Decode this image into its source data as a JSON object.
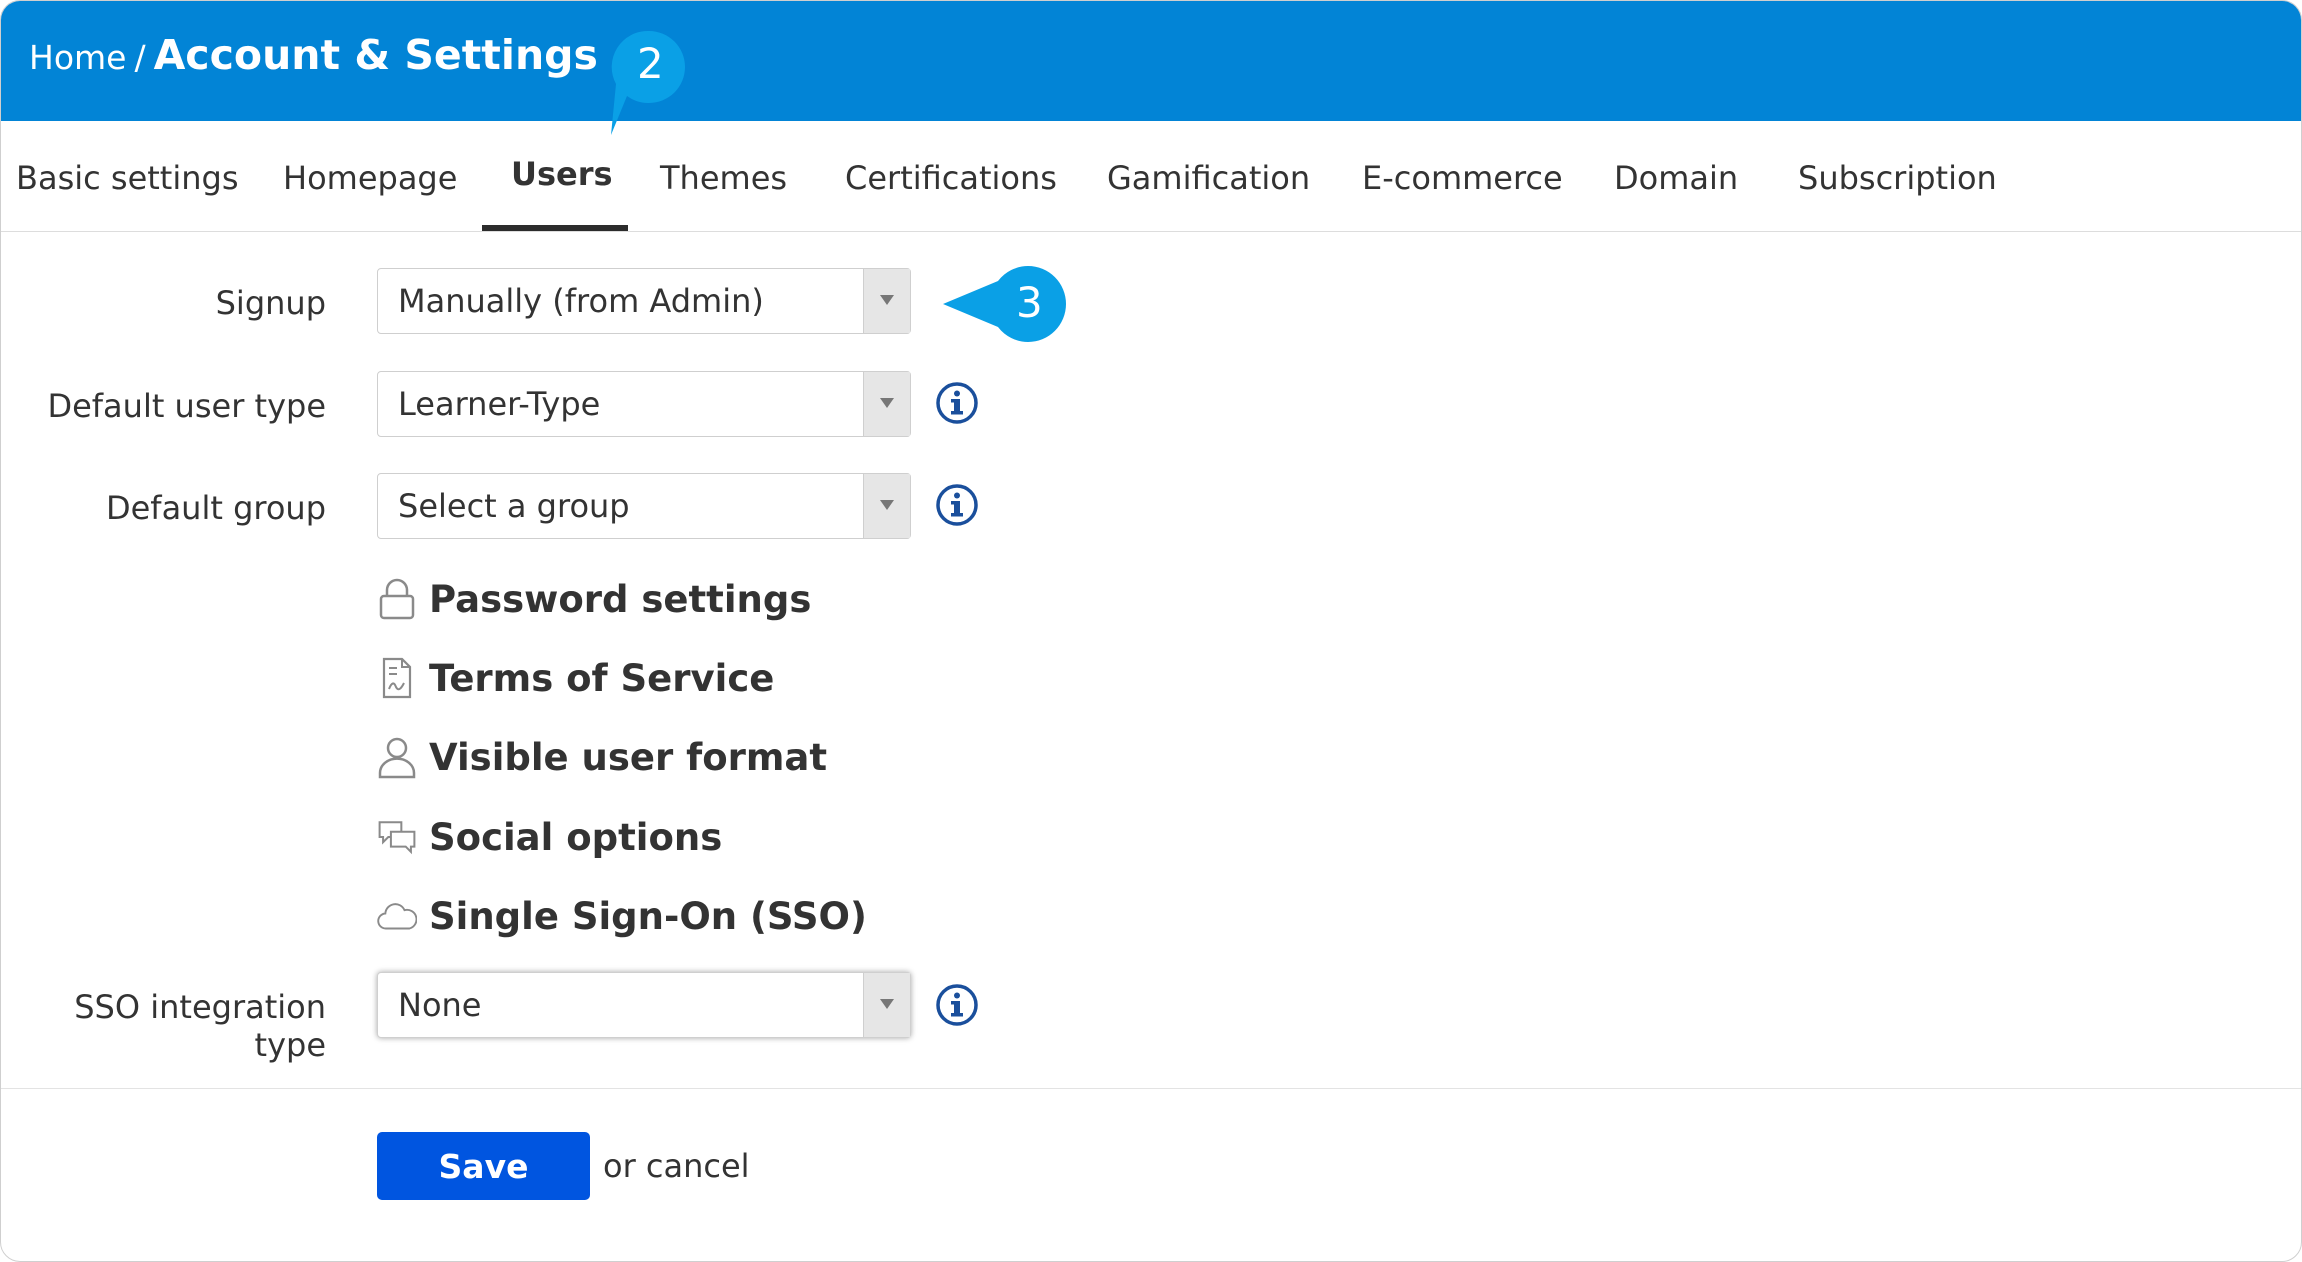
{
  "header": {
    "breadcrumb_home": "Home",
    "breadcrumb_sep": "/",
    "title": "Account & Settings",
    "bg_color": "#0284d6"
  },
  "tabs": [
    {
      "label": "Basic settings"
    },
    {
      "label": "Homepage"
    },
    {
      "label": "Users",
      "active": true
    },
    {
      "label": "Themes"
    },
    {
      "label": "Certifications"
    },
    {
      "label": "Gamification"
    },
    {
      "label": "E-commerce"
    },
    {
      "label": "Domain"
    },
    {
      "label": "Subscription"
    }
  ],
  "form": {
    "signup_label": "Signup",
    "signup_value": "Manually (from Admin)",
    "default_user_type_label": "Default user type",
    "default_user_type_value": "Learner-Type",
    "default_group_label": "Default group",
    "default_group_value": "Select a group",
    "sso_type_label": "SSO integration type",
    "sso_type_value": "None"
  },
  "sections": [
    {
      "label": "Password settings",
      "icon": "lock-icon"
    },
    {
      "label": "Terms of Service",
      "icon": "document-icon"
    },
    {
      "label": "Visible user format",
      "icon": "user-icon"
    },
    {
      "label": "Social options",
      "icon": "chat-bubbles-icon"
    },
    {
      "label": "Single Sign-On (SSO)",
      "icon": "cloud-icon"
    }
  ],
  "actions": {
    "save_label": "Save",
    "cancel_label": "or cancel",
    "save_color": "#0055e0"
  },
  "callouts": {
    "tabs_step": "2",
    "signup_step": "3",
    "color": "#0aa0e6"
  }
}
